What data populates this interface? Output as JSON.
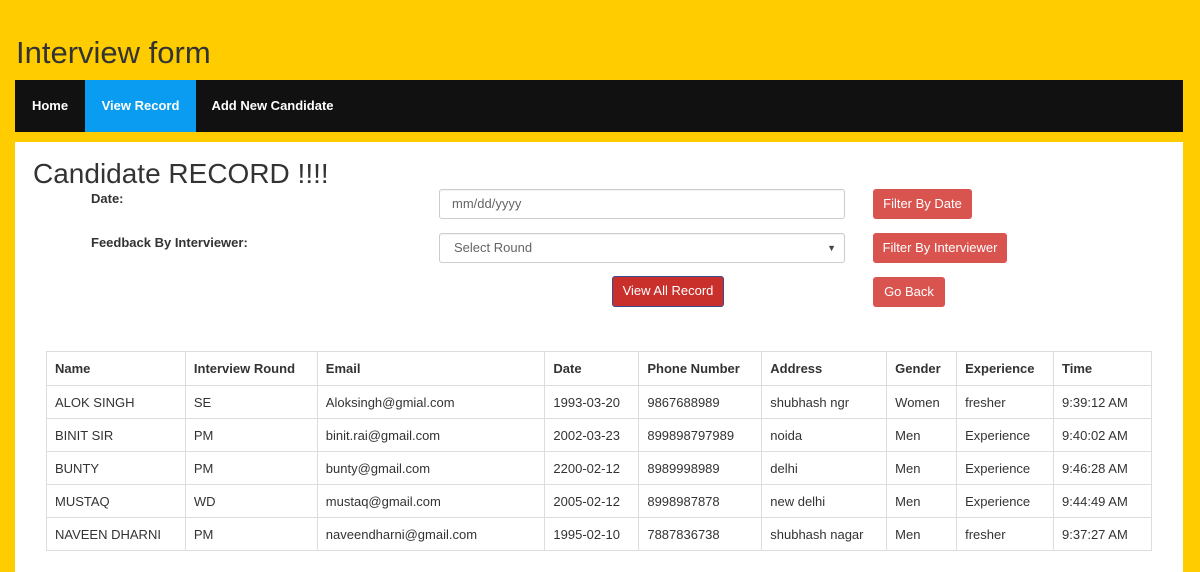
{
  "app": {
    "title": "Interview form"
  },
  "nav": {
    "items": [
      {
        "label": "Home"
      },
      {
        "label": "View Record"
      },
      {
        "label": "Add New Candidate"
      }
    ]
  },
  "page": {
    "heading": "Candidate RECORD !!!!"
  },
  "filters": {
    "date_label": "Date:",
    "date_placeholder": "mm/dd/yyyy",
    "feedback_label": "Feedback By Interviewer:",
    "round_select_value": "Select Round",
    "filter_date_button": "Filter By Date",
    "filter_interviewer_button": "Filter By Interviewer",
    "view_all_button": "View All Record",
    "go_back_button": "Go Back"
  },
  "table": {
    "headers": [
      "Name",
      "Interview Round",
      "Email",
      "Date",
      "Phone Number",
      "Address",
      "Gender",
      "Experience",
      "Time"
    ],
    "rows": [
      [
        "ALOK SINGH",
        "SE",
        "Aloksingh@gmial.com",
        "1993-03-20",
        "9867688989",
        "shubhash ngr",
        "Women",
        "fresher",
        "9:39:12 AM"
      ],
      [
        "BINIT SIR",
        "PM",
        "binit.rai@gmail.com",
        "2002-03-23",
        "899898797989",
        "noida",
        "Men",
        "Experience",
        "9:40:02 AM"
      ],
      [
        "BUNTY",
        "PM",
        "bunty@gmail.com",
        "2200-02-12",
        "8989998989",
        "delhi",
        "Men",
        "Experience",
        "9:46:28 AM"
      ],
      [
        "MUSTAQ",
        "WD",
        "mustaq@gmail.com",
        "2005-02-12",
        "8998987878",
        "new delhi",
        "Men",
        "Experience",
        "9:44:49 AM"
      ],
      [
        "NAVEEN DHARNI",
        "PM",
        "naveendharni@gmail.com",
        "1995-02-10",
        "7887836738",
        "shubhash nagar",
        "Men",
        "fresher",
        "9:37:27 AM"
      ]
    ]
  }
}
